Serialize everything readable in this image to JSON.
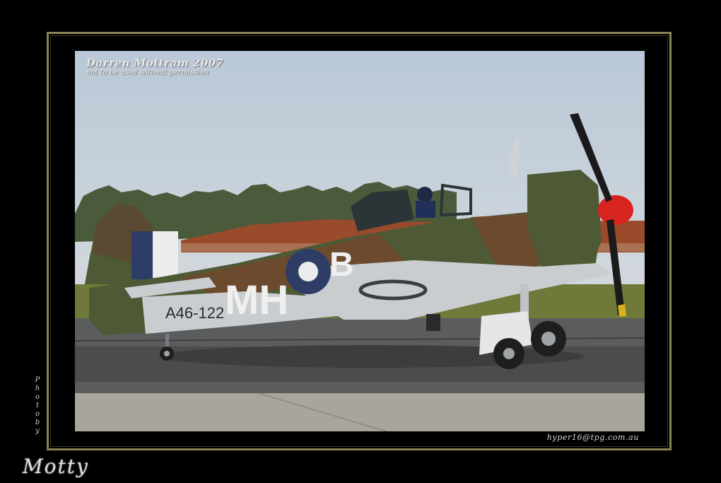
{
  "watermark": {
    "name": "Darren Mottram 2007",
    "note": "not to be used without permission"
  },
  "email": "hyper16@tpg.com.au",
  "photo_by_letters": [
    "P",
    "h",
    "o",
    "t",
    "o",
    "b",
    "y"
  ],
  "signature": "Motty",
  "aircraft": {
    "code_letters": "MH",
    "code_letter_2": "B",
    "serial": "A46-122"
  },
  "colors": {
    "frame": "#8a8450",
    "camo_green": "#4e5a36",
    "camo_brown": "#6b4a2e",
    "spinner_red": "#d8231f",
    "underside_silver": "#c9cdd0"
  }
}
